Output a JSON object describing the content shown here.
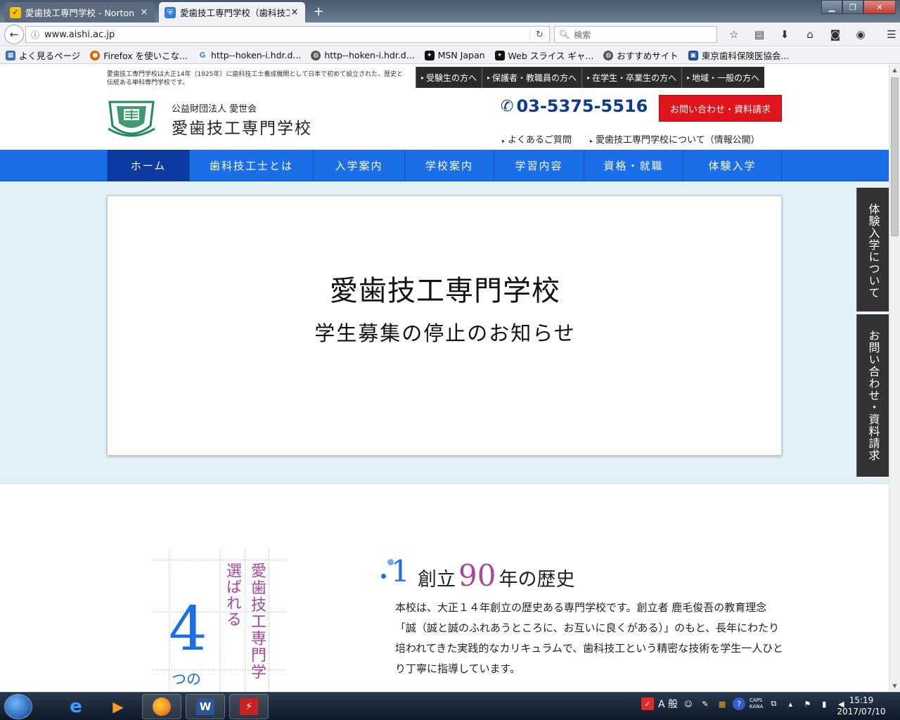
{
  "browser": {
    "tabs": [
      {
        "label": "愛歯技工専門学校 - Norton",
        "close": "×"
      },
      {
        "label": "愛歯技工専門学校（歯科技工",
        "close": "×"
      }
    ],
    "new_tab": "+",
    "window_controls": {
      "minimize": "▁",
      "maximize": "❐",
      "close": "✕"
    },
    "url": "www.aishi.ac.jp",
    "search_placeholder": "検索",
    "bookmarks": [
      {
        "label": "よく見るページ",
        "icon": "chart-icon"
      },
      {
        "label": "Firefox を使いこな...",
        "icon": "firefox-icon"
      },
      {
        "label": "http--hoken-i.hdr.d...",
        "icon": "google-icon"
      },
      {
        "label": "http--hoken-i.hdr.d...",
        "icon": "globe-icon"
      },
      {
        "label": "MSN Japan",
        "icon": "msn-icon"
      },
      {
        "label": "Web スライス ギャ...",
        "icon": "msn-icon"
      },
      {
        "label": "おすすめサイト",
        "icon": "globe-icon"
      },
      {
        "label": "東京歯科保険医協会...",
        "icon": "site-icon"
      }
    ]
  },
  "site": {
    "tagline": "愛歯技工専門学校は大正14年（1925年）に歯科技工士養成機関として日本で初めて設立された、歴史と伝統ある単科専門学校です。",
    "audience_nav": [
      "受験生の方へ",
      "保護者・教職員の方へ",
      "在学生・卒業生の方へ",
      "地域・一般の方へ"
    ],
    "org": "公益財団法人 愛世会",
    "school_name": "愛歯技工専門学校",
    "phone": "03-5375-5516",
    "contact_button": "お問い合わせ・資料請求",
    "sub_links": [
      "よくあるご質問",
      "愛歯技工専門学校について（情報公開）"
    ],
    "main_nav": [
      "ホーム",
      "歯科技工士とは",
      "入学案内",
      "学校案内",
      "学習内容",
      "資格・就職",
      "体験入学"
    ],
    "hero": {
      "title": "愛歯技工専門学校",
      "subtitle": "学生募集の停止のお知らせ"
    },
    "side_tabs": [
      "体験入学について",
      "お問い合わせ・資料請求"
    ],
    "features": {
      "count": "4",
      "count_suffix": "つの",
      "chosen": "選ばれる",
      "school": "愛歯技工専門学",
      "item1": {
        "number": "1",
        "title_pre": "創立",
        "title_num": "90",
        "title_post": "年の歴史",
        "body": "本校は、大正１４年創立の歴史ある専門学校です。創立者 鹿毛俊吾の教育理念「誠（誠と誠のふれあうところに、お互いに良くがある）」のもと、長年にわたり培われてきた実践的なカリキュラムで、歯科技工という精密な技術を学生一人ひとり丁寧に指導しています。"
      }
    }
  },
  "taskbar": {
    "time": "15:19",
    "date": "2017/07/10",
    "ime": "A 般",
    "caps": "CAPS",
    "kana": "KANA"
  }
}
